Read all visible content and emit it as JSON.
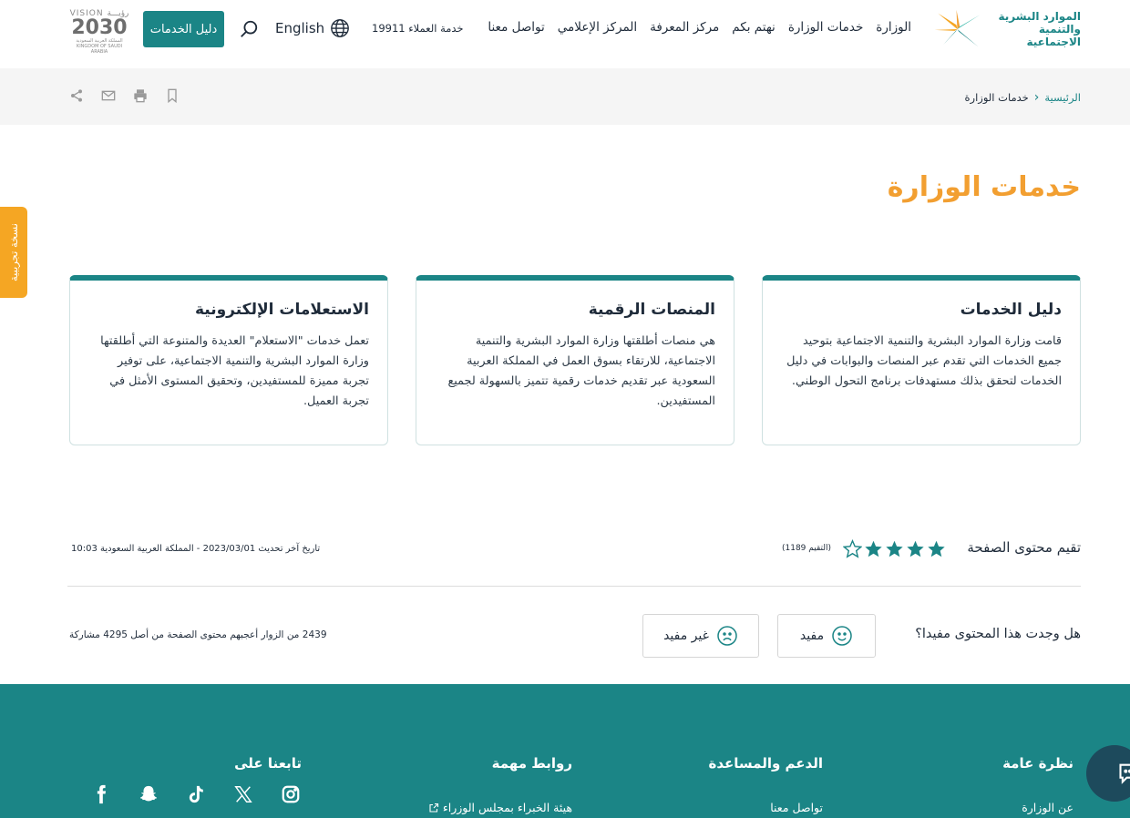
{
  "header": {
    "logo_text_line1": "الموارد البشرية",
    "logo_text_line2": "والتنمية الاجتماعية",
    "nav": [
      "الوزارة",
      "خدمات الوزارة",
      "نهتم بكم",
      "مركز المعرفة",
      "المركز الإعلامي",
      "تواصل معنا"
    ],
    "hotline": "خدمة العملاء 19911",
    "language": "English",
    "guide_button": "دليل الخدمات",
    "vision_top": "VISION رؤيـــة",
    "vision_year": "2030",
    "vision_sub": "المملكة العربية السعودية KINGDOM OF SAUDI ARABIA"
  },
  "breadcrumb": {
    "home": "الرئيسية",
    "current": "خدمات الوزارة"
  },
  "page_title": "خدمات الوزارة",
  "side_tab": "نسخة تجريبية",
  "cards": [
    {
      "title": "دليل الخدمات",
      "text": "قامت وزارة الموارد البشرية والتنمية الاجتماعية بتوحيد جميع الخدمات التي تقدم عبر المنصات والبوابات في دليل الخدمات لتحقق بذلك مستهدفات برنامج التحول الوطني."
    },
    {
      "title": "المنصات الرقمية",
      "text": "هي منصات أطلقتها وزارة الموارد البشرية والتنمية الاجتماعية، للارتقاء بسوق العمل في المملكة العربية السعودية عبر تقديم خدمات رقمية تتميز بالسهولة لجميع المستفيدين."
    },
    {
      "title": "الاستعلامات الإلكترونية",
      "text": "تعمل خدمات \"الاستعلام\" العديدة والمتنوعة التي أطلقتها وزارة الموارد البشرية والتنمية الاجتماعية، على توفير تجربة مميزة للمستفيدين، وتحقيق المستوى الأمثل في تجربة العميل."
    }
  ],
  "rating": {
    "label": "تقيم محتوى الصفحة",
    "stars_filled": 4,
    "stars_total": 5,
    "count_text": "(التقيم 1189)"
  },
  "update": {
    "text": "تاريخ آخر تحديث  2023/03/01  - المملكة العربية السعودية  10:03"
  },
  "feedback": {
    "question": "هل وجدت هذا المحتوى مفيدا؟",
    "useful": "مفيد",
    "not_useful": "غير مفيد",
    "stats": "2439 من الزوار أعجبهم محتوى الصفحة من أصل 4295 مشاركة"
  },
  "footer": {
    "col1_title": "نظرة عامة",
    "col1_link": "عن الوزارة",
    "col2_title": "الدعم والمساعدة",
    "col2_link": "تواصل معنا",
    "col3_title": "روابط مهمة",
    "col3_link": "هيئة الخبراء بمجلس الوزراء",
    "col4_title": "تابعنا على",
    "social_icons": [
      "instagram-icon",
      "x-icon",
      "tiktok-icon",
      "snapchat-icon",
      "facebook-icon"
    ]
  },
  "colors": {
    "primary": "#1b8586",
    "accent": "#f29f31",
    "tab": "#f5a623",
    "chat": "#1d4a5c"
  }
}
